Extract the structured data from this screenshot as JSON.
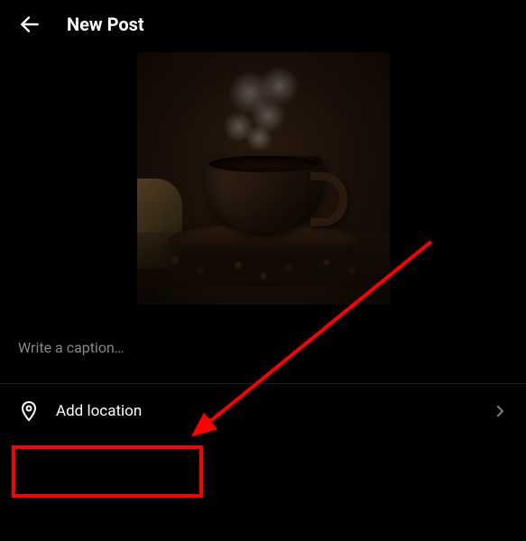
{
  "header": {
    "title": "New Post"
  },
  "caption": {
    "placeholder": "Write a caption…"
  },
  "location": {
    "label": "Add location"
  },
  "image": {
    "description": "steaming-coffee-cup"
  }
}
